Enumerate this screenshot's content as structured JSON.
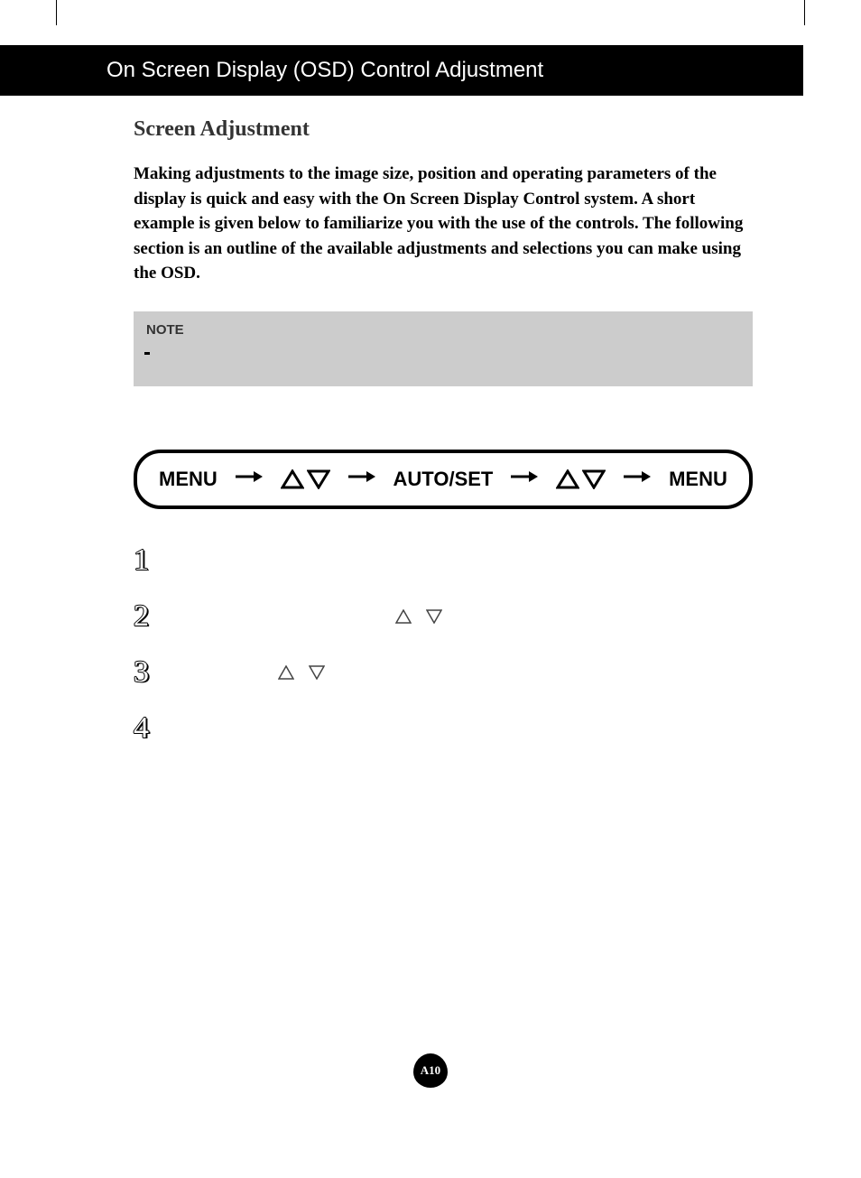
{
  "header": {
    "title": "On Screen Display (OSD) Control Adjustment"
  },
  "section": {
    "heading": "Screen Adjustment",
    "intro": "Making adjustments to the image size, position and operating parameters of the display is quick and easy with the On Screen Display Control system. A short example is given below to familiarize you with the use of the controls. The following section is an outline of the available adjustments and selections you can make using the OSD."
  },
  "note": {
    "label": "NOTE"
  },
  "sequence": {
    "menu1": "MENU",
    "autoset": "AUTO/SET",
    "menu2": "MENU"
  },
  "steps": {
    "n1": "1",
    "n2": "2",
    "n3": "3",
    "n4": "4"
  },
  "page_number": "A10"
}
